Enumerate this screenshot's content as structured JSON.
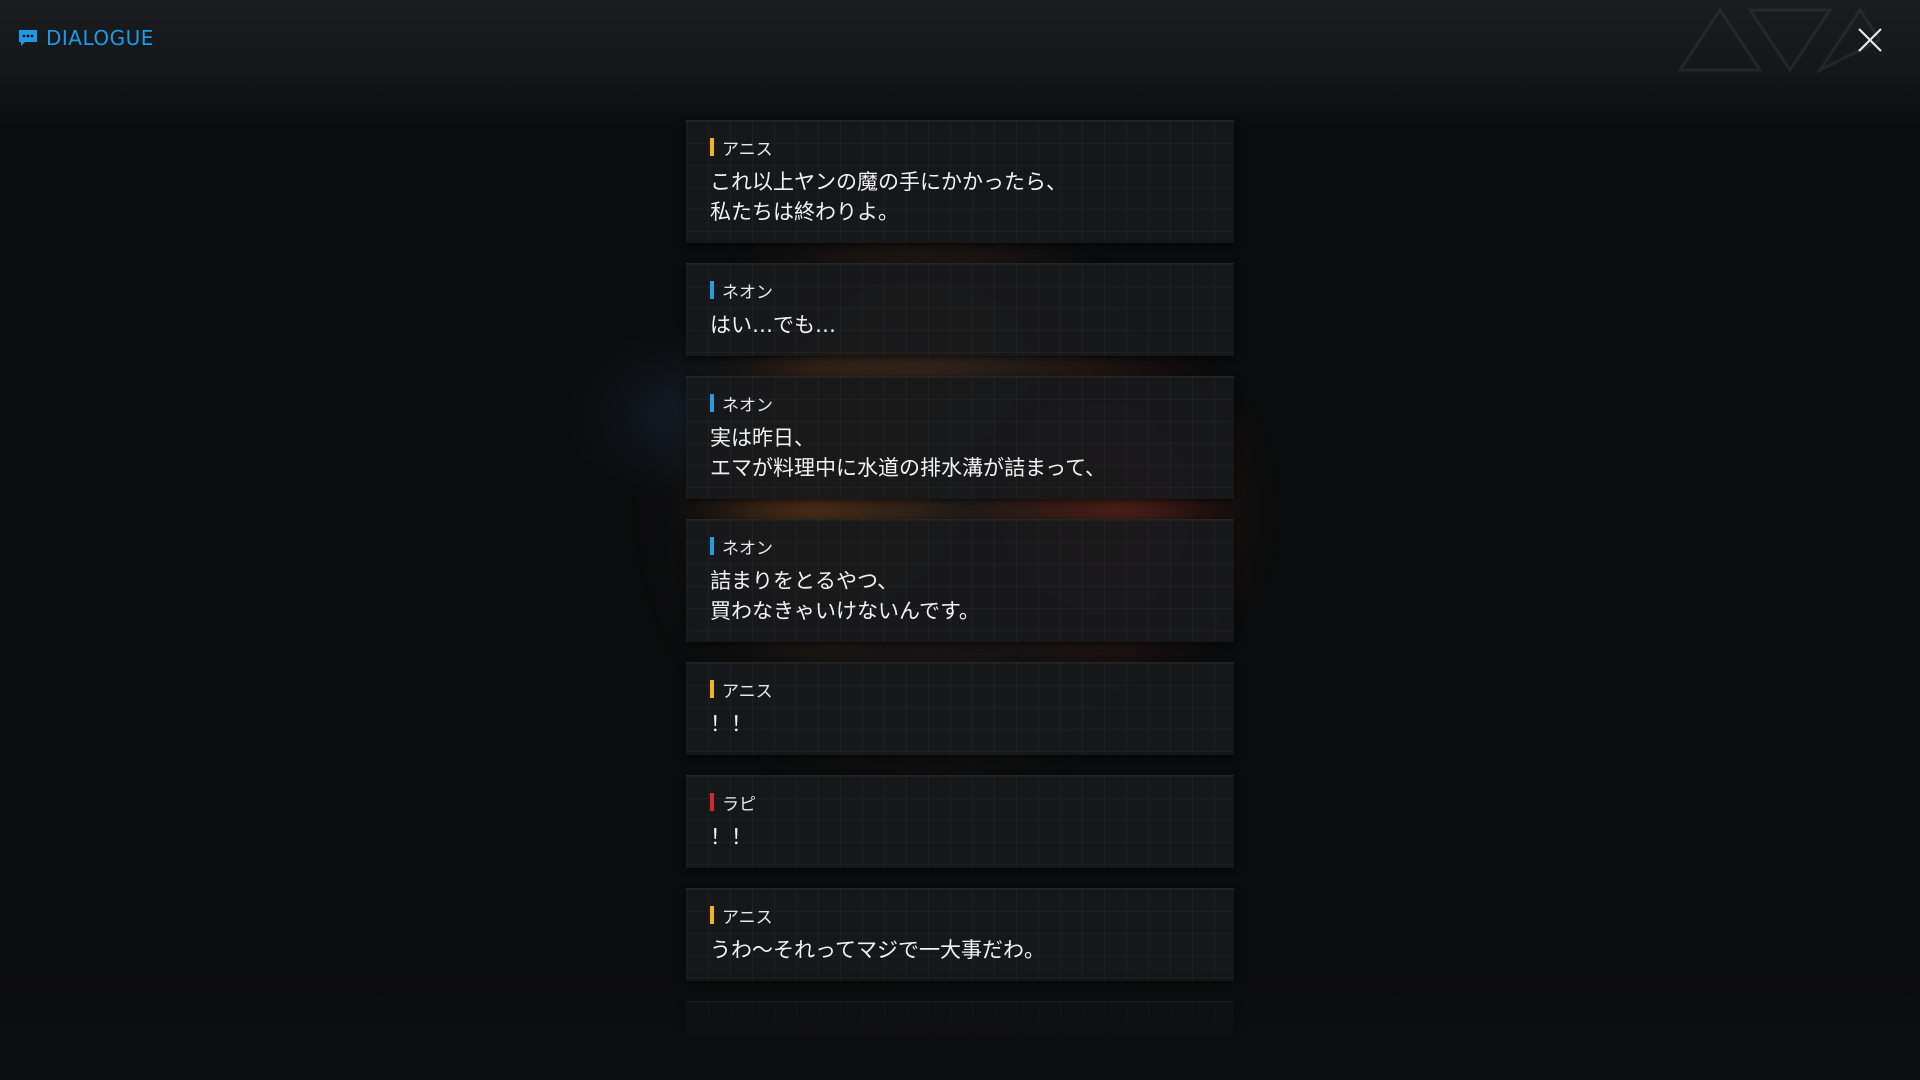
{
  "header": {
    "title": "DIALOGUE",
    "title_icon": "chat-bubble-icon",
    "close_icon": "close-icon",
    "accent_color": "#1e9be6"
  },
  "speaker_colors": {
    "アニス": "#f0b428",
    "ネオン": "#2a9be0",
    "ラピ": "#d02a2a"
  },
  "dialogue": [
    {
      "speaker": "アニス",
      "color": "#f0b428",
      "text": "これ以上ヤンの魔の手にかかったら、\n私たちは終わりよ。"
    },
    {
      "speaker": "ネオン",
      "color": "#2a9be0",
      "text": "はい…でも…"
    },
    {
      "speaker": "ネオン",
      "color": "#2a9be0",
      "text": "実は昨日、\nエマが料理中に水道の排水溝が詰まって、"
    },
    {
      "speaker": "ネオン",
      "color": "#2a9be0",
      "text": "詰まりをとるやつ、\n買わなきゃいけないんです。"
    },
    {
      "speaker": "アニス",
      "color": "#f0b428",
      "text": "！！"
    },
    {
      "speaker": "ラピ",
      "color": "#d02a2a",
      "text": "！！"
    },
    {
      "speaker": "アニス",
      "color": "#f0b428",
      "text": "うわ～それってマジで一大事だわ。"
    }
  ]
}
